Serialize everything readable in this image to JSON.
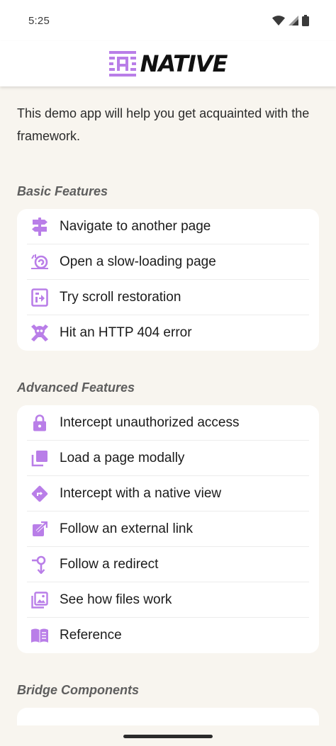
{
  "status_bar": {
    "time": "5:25"
  },
  "header": {
    "logo_text": "NATIVE"
  },
  "intro": "This demo app will help you get acquainted with the framework.",
  "sections": [
    {
      "title": "Basic Features",
      "items": [
        {
          "label": "Navigate to another page",
          "icon": "signpost-icon"
        },
        {
          "label": "Open a slow-loading page",
          "icon": "snail-icon"
        },
        {
          "label": "Try scroll restoration",
          "icon": "scroll-restore-icon"
        },
        {
          "label": "Hit an HTTP 404 error",
          "icon": "skull-crossbones-icon"
        }
      ]
    },
    {
      "title": "Advanced Features",
      "items": [
        {
          "label": "Intercept unauthorized access",
          "icon": "lock-icon"
        },
        {
          "label": "Load a page modally",
          "icon": "layers-icon"
        },
        {
          "label": "Intercept with a native view",
          "icon": "directions-icon"
        },
        {
          "label": "Follow an external link",
          "icon": "external-link-icon"
        },
        {
          "label": "Follow a redirect",
          "icon": "redirect-icon"
        },
        {
          "label": "See how files work",
          "icon": "image-file-icon"
        },
        {
          "label": "Reference",
          "icon": "book-icon"
        }
      ]
    },
    {
      "title": "Bridge Components",
      "items": []
    }
  ],
  "colors": {
    "accent": "#b97ee8",
    "background": "#f8f5ef",
    "card": "#ffffff"
  }
}
